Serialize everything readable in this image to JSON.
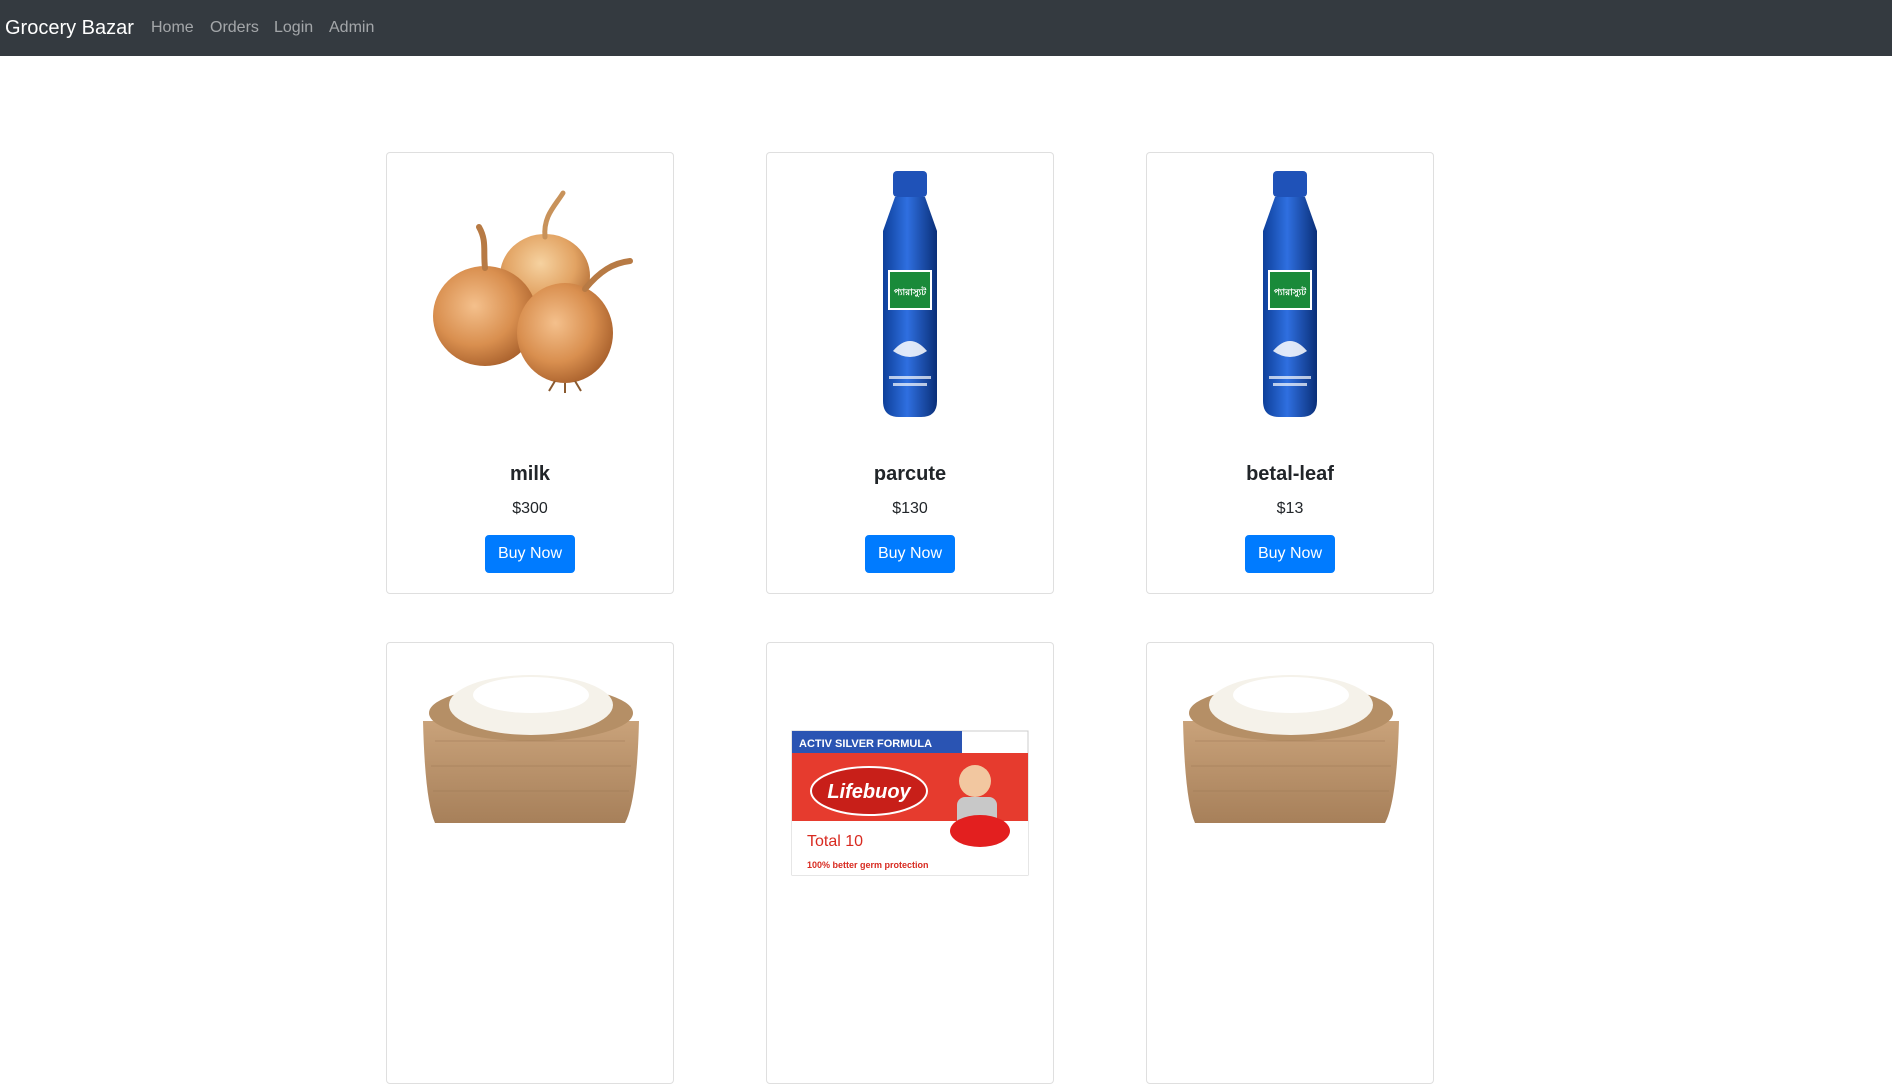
{
  "navbar": {
    "brand": "Grocery Bazar",
    "links": [
      "Home",
      "Orders",
      "Login",
      "Admin"
    ]
  },
  "colors": {
    "navbar_bg": "#343a40",
    "button_primary": "#007bff"
  },
  "products": [
    {
      "name": "milk",
      "price": "$300",
      "button": "Buy Now",
      "image": "onions-image"
    },
    {
      "name": "parcute",
      "price": "$130",
      "button": "Buy Now",
      "image": "parachute-oil-bottle-image"
    },
    {
      "name": "betal-leaf",
      "price": "$13",
      "button": "Buy Now",
      "image": "parachute-oil-bottle-image"
    },
    {
      "name": "",
      "price": "",
      "button": "",
      "image": "rice-sack-image"
    },
    {
      "name": "",
      "price": "",
      "button": "",
      "image": "lifebuoy-soap-image"
    },
    {
      "name": "",
      "price": "",
      "button": "",
      "image": "rice-sack-image"
    }
  ],
  "image_text": {
    "bottle_logo": "প্যারাস্যুট",
    "soap_banner": "ACTIV SILVER FORMULA",
    "soap_brand": "Lifebuoy",
    "soap_variant": "Total 10",
    "soap_claim": "100% better germ protection"
  }
}
